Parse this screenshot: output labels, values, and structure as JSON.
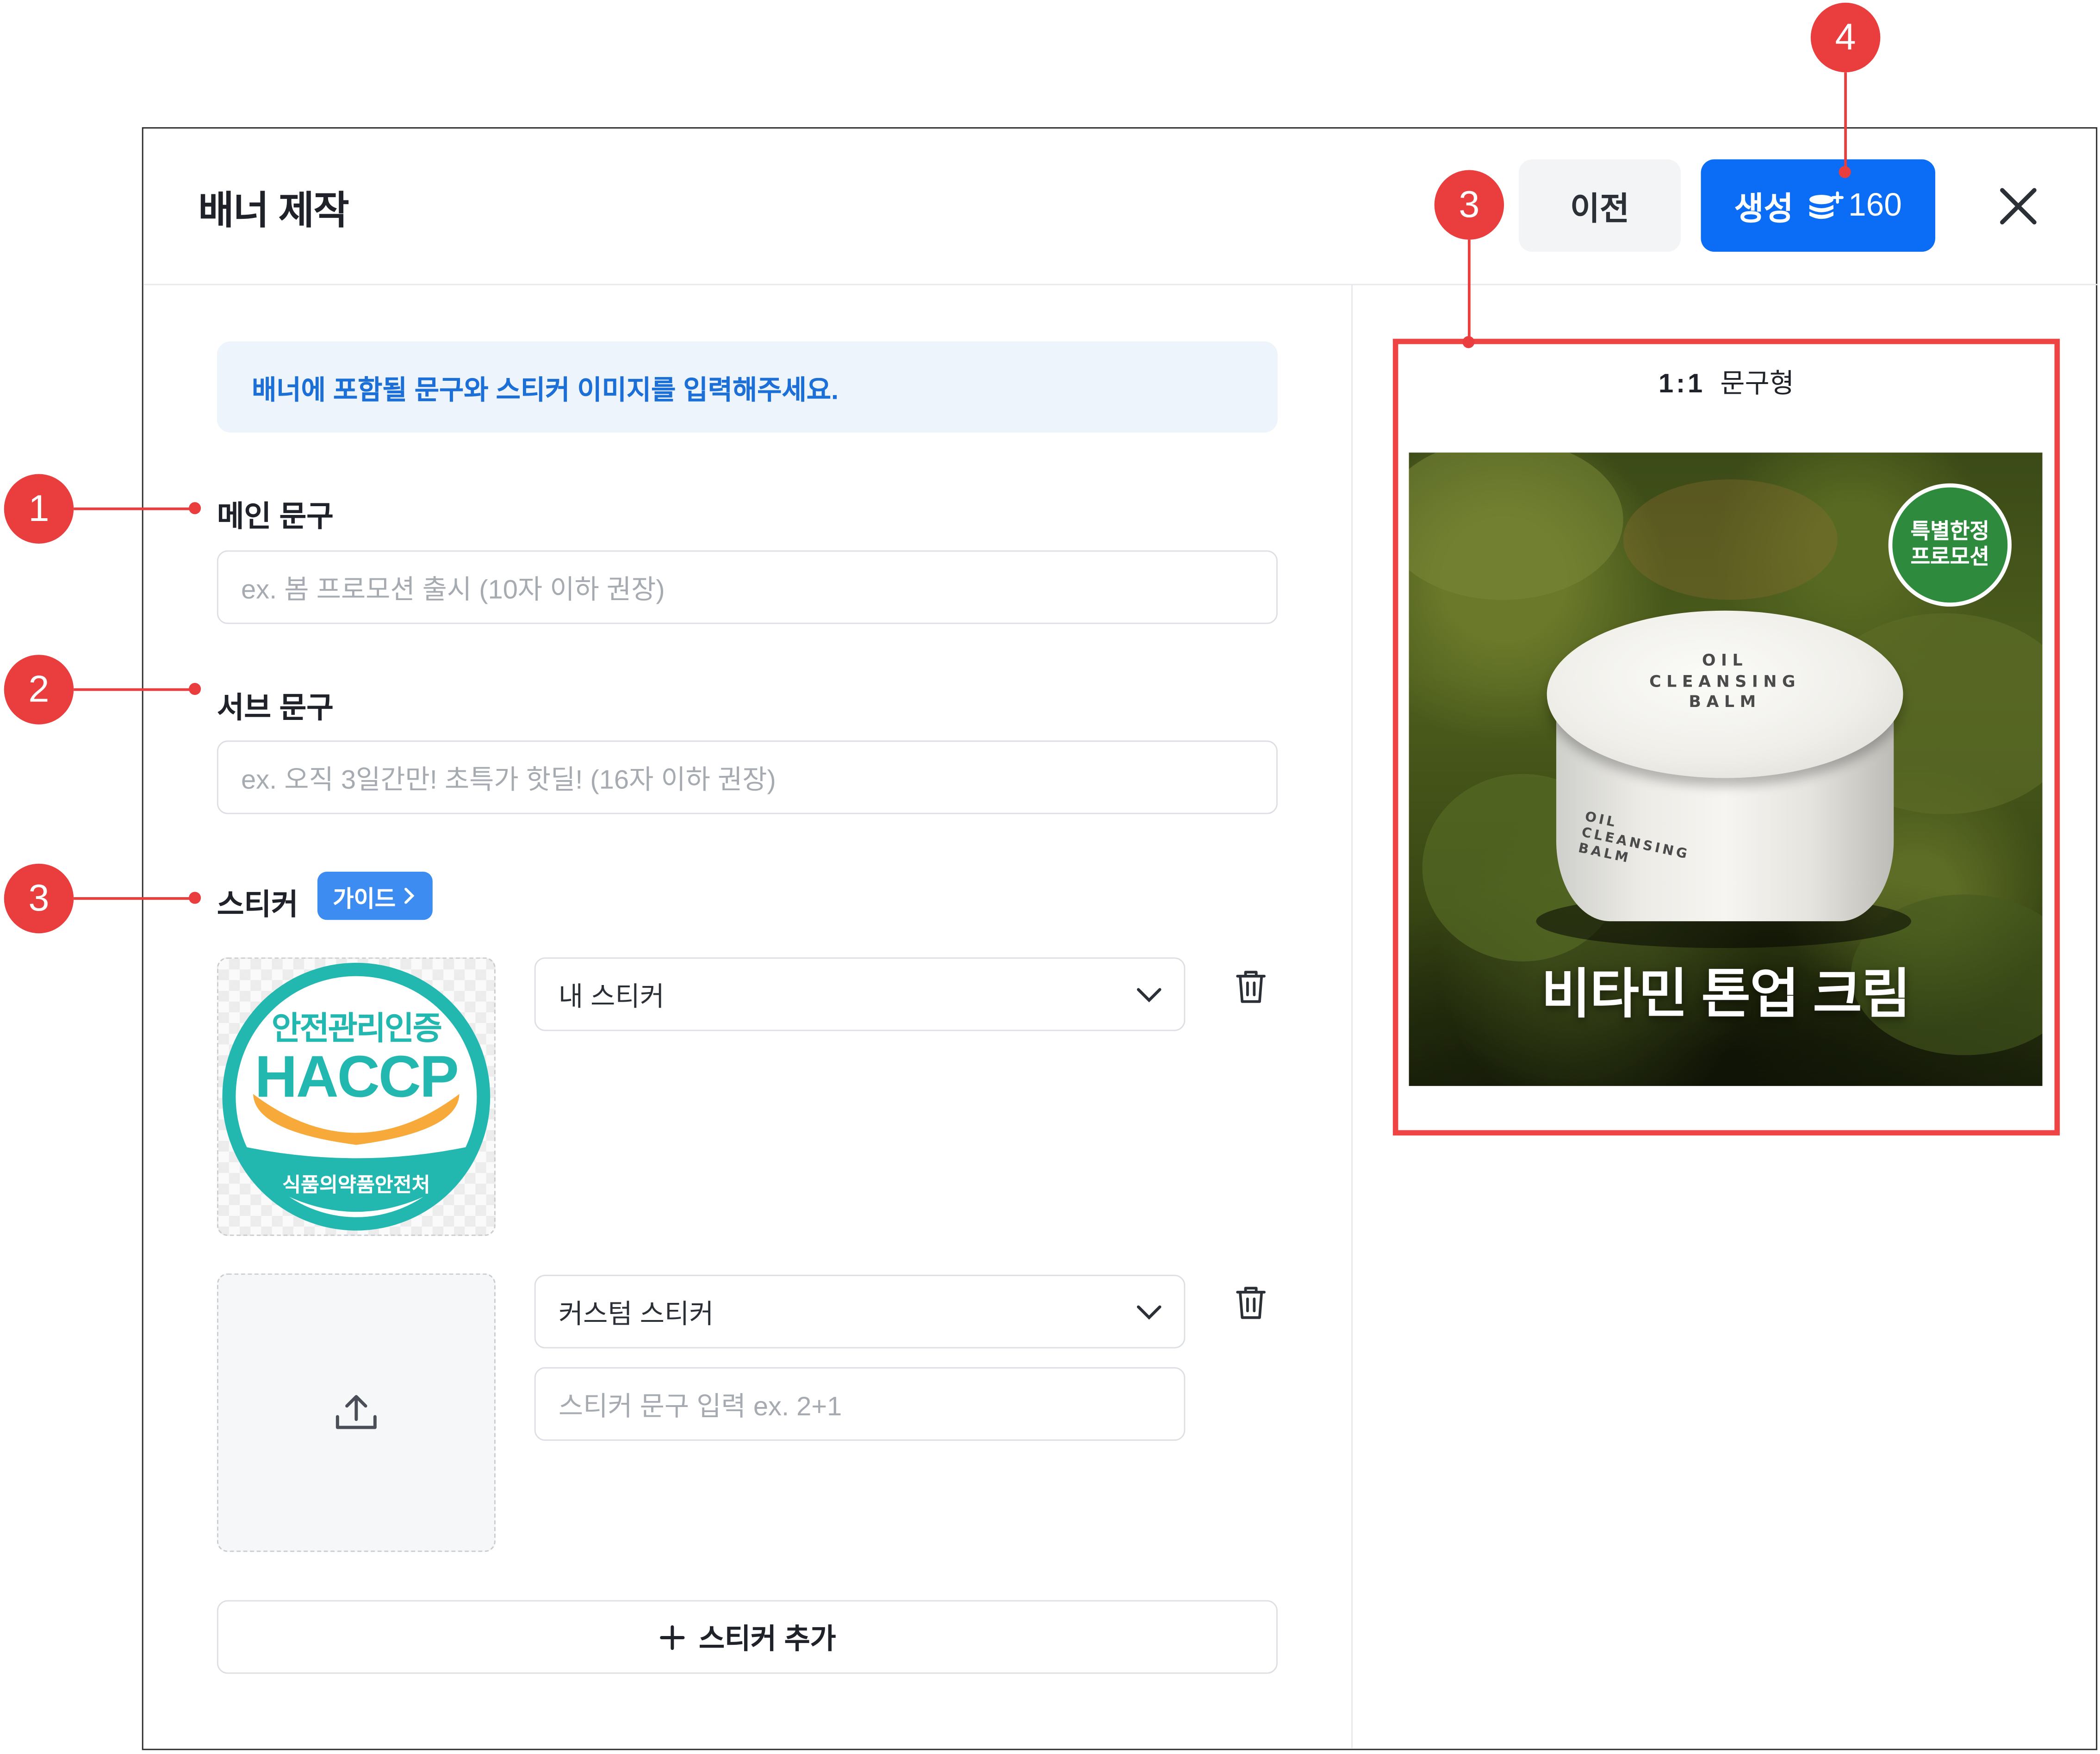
{
  "dialog": {
    "title": "배너 제작",
    "prev_label": "이전",
    "generate_label": "생성",
    "generate_credits": "160"
  },
  "info_message": "배너에 포함될 문구와 스티커 이미지를 입력해주세요.",
  "main_text": {
    "label": "메인 문구",
    "placeholder": "ex. 봄 프로모션 출시 (10자 이하 권장)"
  },
  "sub_text": {
    "label": "서브 문구",
    "placeholder": "ex. 오직 3일간만! 초특가 핫딜! (16자 이하 권장)"
  },
  "sticker": {
    "label": "스티커",
    "guide_label": "가이드",
    "items": [
      {
        "type_selected": "내 스티커",
        "image": {
          "top_text": "안전관리인증",
          "main_text": "HACCP",
          "bottom_text": "식품의약품안전처"
        }
      },
      {
        "type_selected": "커스텀 스티커",
        "text_placeholder": "스티커 문구 입력 ex. 2+1"
      }
    ],
    "add_label": "스티커 추가"
  },
  "preview": {
    "ratio": "1:1",
    "type": "문구형",
    "banner_title": "비타민 톤업 크림",
    "promo_sticker_lines": [
      "특별한정",
      "프로모션"
    ],
    "product_lid_text": [
      "OIL",
      "CLEANSING",
      "BALM"
    ],
    "product_side_text": [
      "OIL",
      "CLEANSING",
      "BALM"
    ]
  },
  "annotations": [
    "1",
    "2",
    "3",
    "3",
    "4"
  ],
  "colors": {
    "primary": "#0b6cf5",
    "annotation": "#ea3d3d",
    "info_bg": "#eef4fb",
    "haccp_teal": "#22b8b0",
    "haccp_orange": "#f7a93a"
  }
}
